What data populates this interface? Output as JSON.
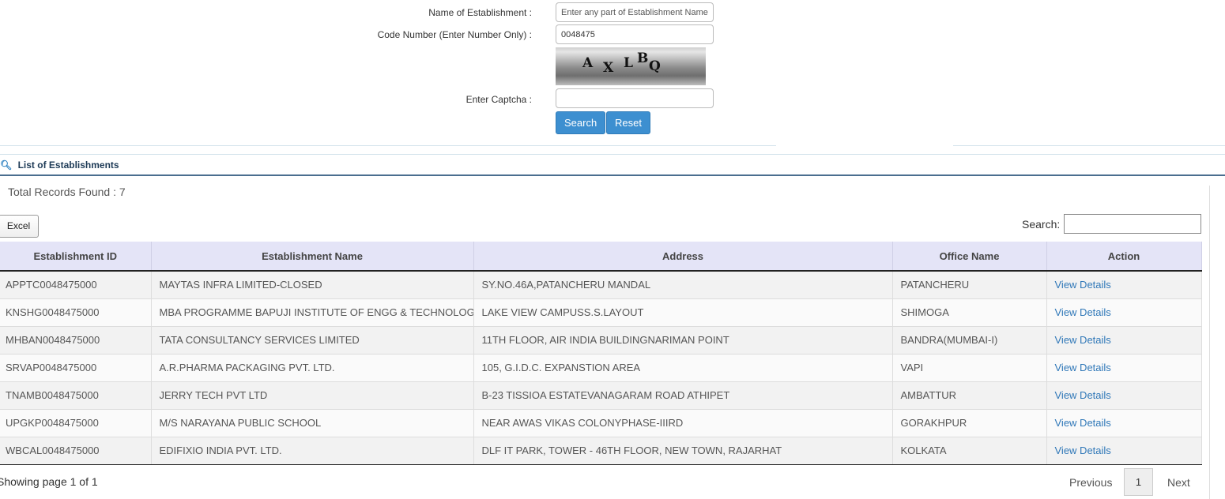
{
  "form": {
    "name_label": "Name of Establishment :",
    "name_placeholder": "Enter any part of Establishment Name",
    "code_label": "Code Number (Enter Number Only) :",
    "code_value": "0048475",
    "captcha_chars": [
      "A",
      "X",
      "L",
      "B",
      "Q"
    ],
    "captcha_label": "Enter Captcha :",
    "captcha_value": "",
    "search_label": "Search",
    "reset_label": "Reset"
  },
  "section": {
    "icon": "search-icon",
    "title": "List of Establishments"
  },
  "total_records": "Total Records Found : 7",
  "toolbar": {
    "excel_label": "Excel",
    "search_label": "Search:",
    "search_value": ""
  },
  "table": {
    "columns": [
      "Establishment ID",
      "Establishment Name",
      "Address",
      "Office Name",
      "Action"
    ],
    "rows": [
      {
        "id": "APPTC0048475000",
        "name": "MAYTAS INFRA LIMITED-CLOSED",
        "address": "SY.NO.46A,PATANCHERU MANDAL",
        "office": "PATANCHERU",
        "action": "View Details"
      },
      {
        "id": "KNSHG0048475000",
        "name": "MBA PROGRAMME BAPUJI INSTITUTE OF ENGG & TECHNOLOGY",
        "address": "LAKE VIEW CAMPUSS.S.LAYOUT",
        "office": "SHIMOGA",
        "action": "View Details"
      },
      {
        "id": "MHBAN0048475000",
        "name": "TATA CONSULTANCY SERVICES LIMITED",
        "address": "11TH FLOOR, AIR INDIA BUILDINGNARIMAN POINT",
        "office": "BANDRA(MUMBAI-I)",
        "action": "View Details"
      },
      {
        "id": "SRVAP0048475000",
        "name": "A.R.PHARMA PACKAGING PVT. LTD.",
        "address": "105, G.I.D.C. EXPANSTION AREA",
        "office": "VAPI",
        "action": "View Details"
      },
      {
        "id": "TNAMB0048475000",
        "name": "JERRY TECH PVT LTD",
        "address": "B-23 TISSIOA ESTATEVANAGARAM ROAD ATHIPET",
        "office": "AMBATTUR",
        "action": "View Details"
      },
      {
        "id": "UPGKP0048475000",
        "name": "M/S NARAYANA PUBLIC SCHOOL",
        "address": "NEAR AWAS VIKAS COLONYPHASE-IIIRD",
        "office": "GORAKHPUR",
        "action": "View Details"
      },
      {
        "id": "WBCAL0048475000",
        "name": "EDIFIXIO INDIA PVT. LTD.",
        "address": "DLF IT PARK, TOWER - 46TH FLOOR, NEW TOWN, RAJARHAT",
        "office": "KOLKATA",
        "action": "View Details"
      }
    ]
  },
  "footer": {
    "info": "Showing page 1 of 1",
    "previous_label": "Previous",
    "current_page": "1",
    "next_label": "Next"
  },
  "colors": {
    "button_blue": "#3d8fd0",
    "header_bg": "#e4e4f7",
    "link": "#3078b8",
    "section_title": "#1d3a56"
  }
}
